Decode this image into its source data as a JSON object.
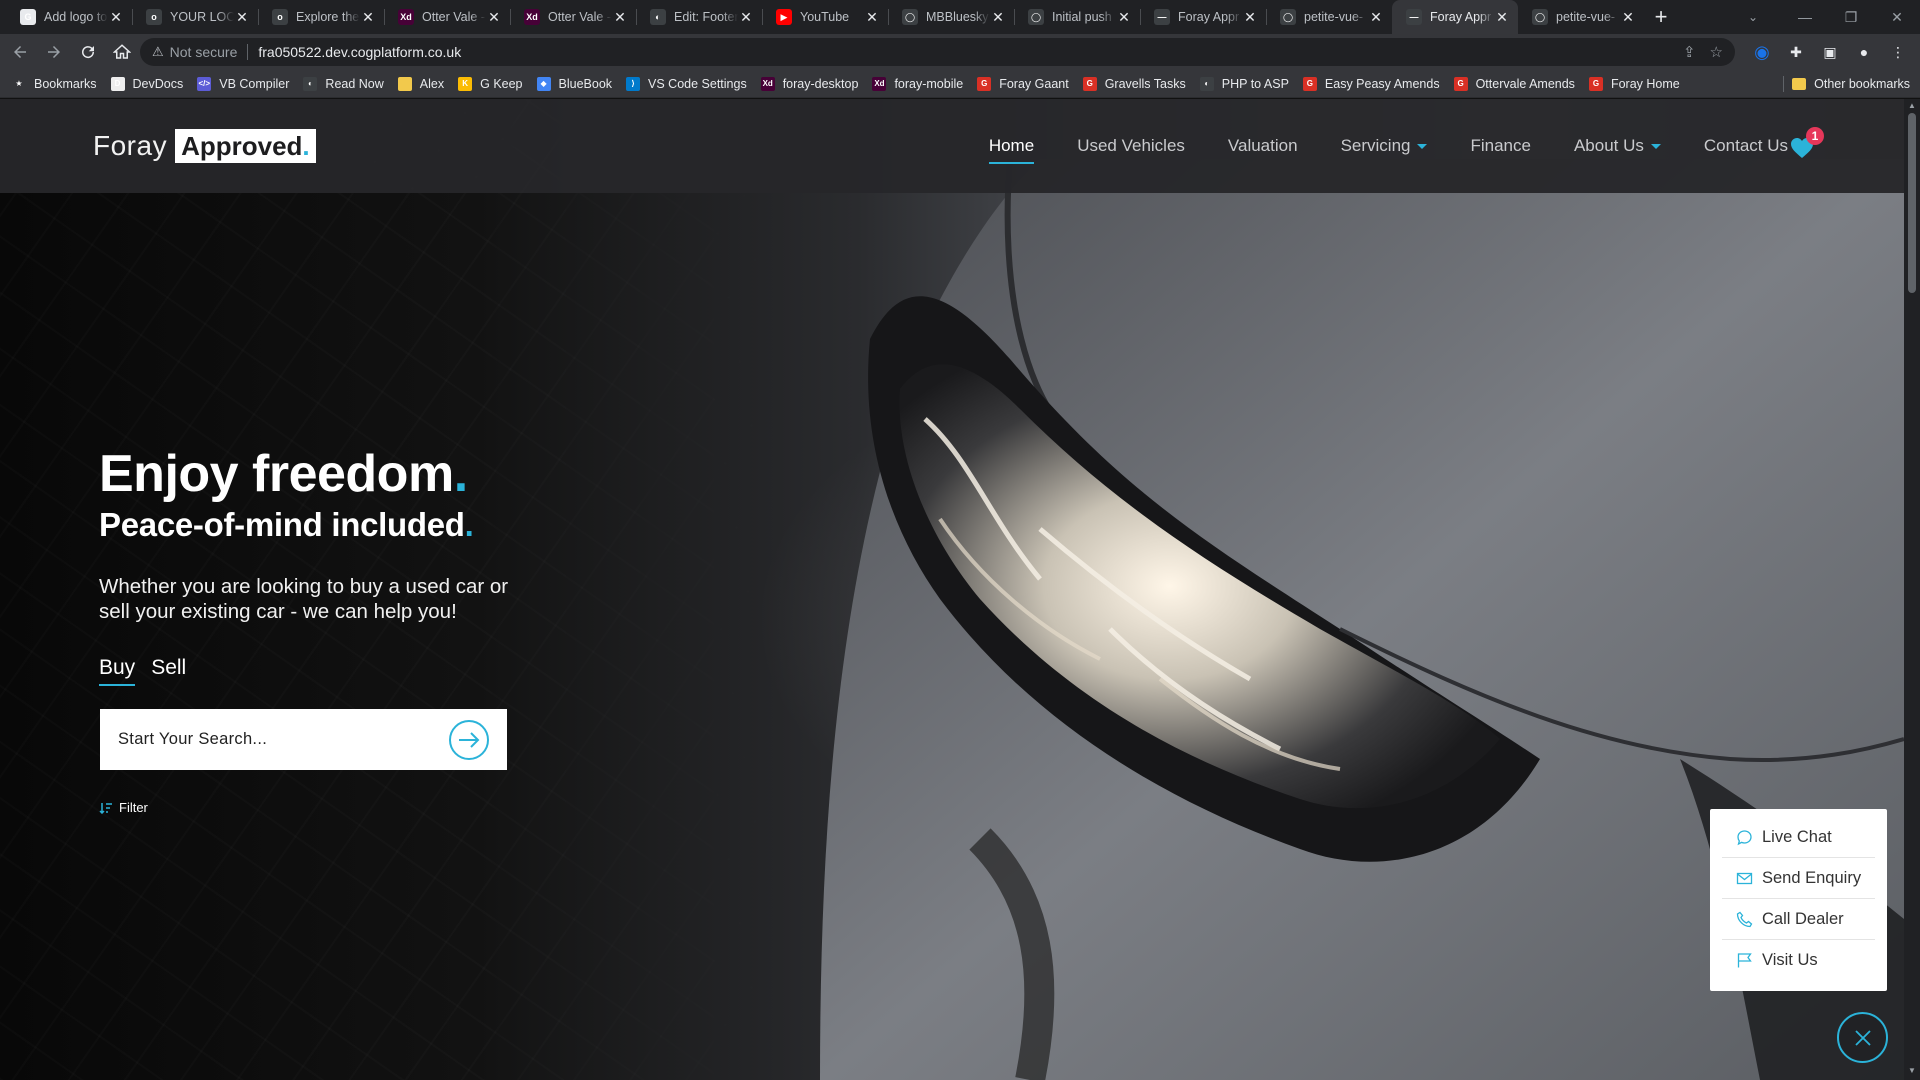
{
  "browser": {
    "tabs": [
      {
        "title": "Add logo to",
        "favicon_color": "#e8eaed",
        "favicon_glyph": "G"
      },
      {
        "title": "YOUR LOCAL",
        "favicon_color": "#3c4043",
        "favicon_glyph": "o"
      },
      {
        "title": "Explore the",
        "favicon_color": "#3c4043",
        "favicon_glyph": "o"
      },
      {
        "title": "Otter Vale -",
        "favicon_color": "#470137",
        "favicon_glyph": "Xd"
      },
      {
        "title": "Otter Vale -",
        "favicon_color": "#470137",
        "favicon_glyph": "Xd"
      },
      {
        "title": "Edit: Footer",
        "favicon_color": "#3c4043",
        "favicon_glyph": "◐"
      },
      {
        "title": "YouTube",
        "favicon_color": "#ff0000",
        "favicon_glyph": "▶"
      },
      {
        "title": "MBBluesky",
        "favicon_color": "#3c4043",
        "favicon_glyph": "◯"
      },
      {
        "title": "Initial push",
        "favicon_color": "#3c4043",
        "favicon_glyph": "◯"
      },
      {
        "title": "Foray Appr",
        "favicon_color": "#3c4043",
        "favicon_glyph": "—"
      },
      {
        "title": "petite-vue-",
        "favicon_color": "#3c4043",
        "favicon_glyph": "◯"
      },
      {
        "title": "Foray Appr",
        "favicon_color": "#3c4043",
        "favicon_glyph": "—",
        "active": true
      },
      {
        "title": "petite-vue-",
        "favicon_color": "#3c4043",
        "favicon_glyph": "◯"
      }
    ],
    "omnibox": {
      "security": "Not secure",
      "url": "fra050522.dev.cogplatform.co.uk"
    },
    "bookmarks": [
      {
        "label": "Bookmarks",
        "color": "#35363a",
        "glyph": "★"
      },
      {
        "label": "DevDocs",
        "color": "#eeeeee",
        "glyph": "D"
      },
      {
        "label": "VB Compiler",
        "color": "#5c5cd6",
        "glyph": "</>"
      },
      {
        "label": "Read Now",
        "color": "#3c4043",
        "glyph": "◐"
      },
      {
        "label": "Alex",
        "color": "#f2c94c",
        "glyph": ""
      },
      {
        "label": "G Keep",
        "color": "#fbbc04",
        "glyph": "K"
      },
      {
        "label": "BlueBook",
        "color": "#4285f4",
        "glyph": "◆"
      },
      {
        "label": "VS Code Settings",
        "color": "#007acc",
        "glyph": "⟩"
      },
      {
        "label": "foray-desktop",
        "color": "#470137",
        "glyph": "Xd"
      },
      {
        "label": "foray-mobile",
        "color": "#470137",
        "glyph": "Xd"
      },
      {
        "label": "Foray Gaant",
        "color": "#d93025",
        "glyph": "G"
      },
      {
        "label": "Gravells Tasks",
        "color": "#d93025",
        "glyph": "G"
      },
      {
        "label": "PHP to ASP",
        "color": "#3c4043",
        "glyph": "◐"
      },
      {
        "label": "Easy Peasy Amends",
        "color": "#d93025",
        "glyph": "G"
      },
      {
        "label": "Ottervale Amends",
        "color": "#d93025",
        "glyph": "G"
      },
      {
        "label": "Foray Home",
        "color": "#d93025",
        "glyph": "G"
      }
    ],
    "other_bookmarks": "Other bookmarks"
  },
  "site": {
    "logo": {
      "part1": "Foray",
      "part2": "Approved",
      "dot": "."
    },
    "nav": [
      {
        "label": "Home",
        "active": true,
        "dropdown": false
      },
      {
        "label": "Used Vehicles",
        "active": false,
        "dropdown": false
      },
      {
        "label": "Valuation",
        "active": false,
        "dropdown": false
      },
      {
        "label": "Servicing",
        "active": false,
        "dropdown": true
      },
      {
        "label": "Finance",
        "active": false,
        "dropdown": false
      },
      {
        "label": "About Us",
        "active": false,
        "dropdown": true
      },
      {
        "label": "Contact Us",
        "active": false,
        "dropdown": false
      }
    ],
    "favourites_count": "1",
    "accent_color": "#2bb3d9",
    "badge_color": "#e6375a",
    "hero": {
      "headline": "Enjoy freedom",
      "subheadline": "Peace-of-mind included",
      "dot": ".",
      "lede": "Whether you are looking to buy a used car or sell your existing car - we can help you!",
      "tabs": [
        {
          "label": "Buy",
          "active": true
        },
        {
          "label": "Sell",
          "active": false
        }
      ],
      "search_placeholder": "Start Your Search...",
      "filter_label": "Filter"
    },
    "contact_panel": [
      {
        "label": "Live Chat",
        "icon": "chat-icon"
      },
      {
        "label": "Send Enquiry",
        "icon": "envelope-icon"
      },
      {
        "label": "Call Dealer",
        "icon": "phone-icon"
      },
      {
        "label": "Visit Us",
        "icon": "flag-icon"
      }
    ]
  }
}
